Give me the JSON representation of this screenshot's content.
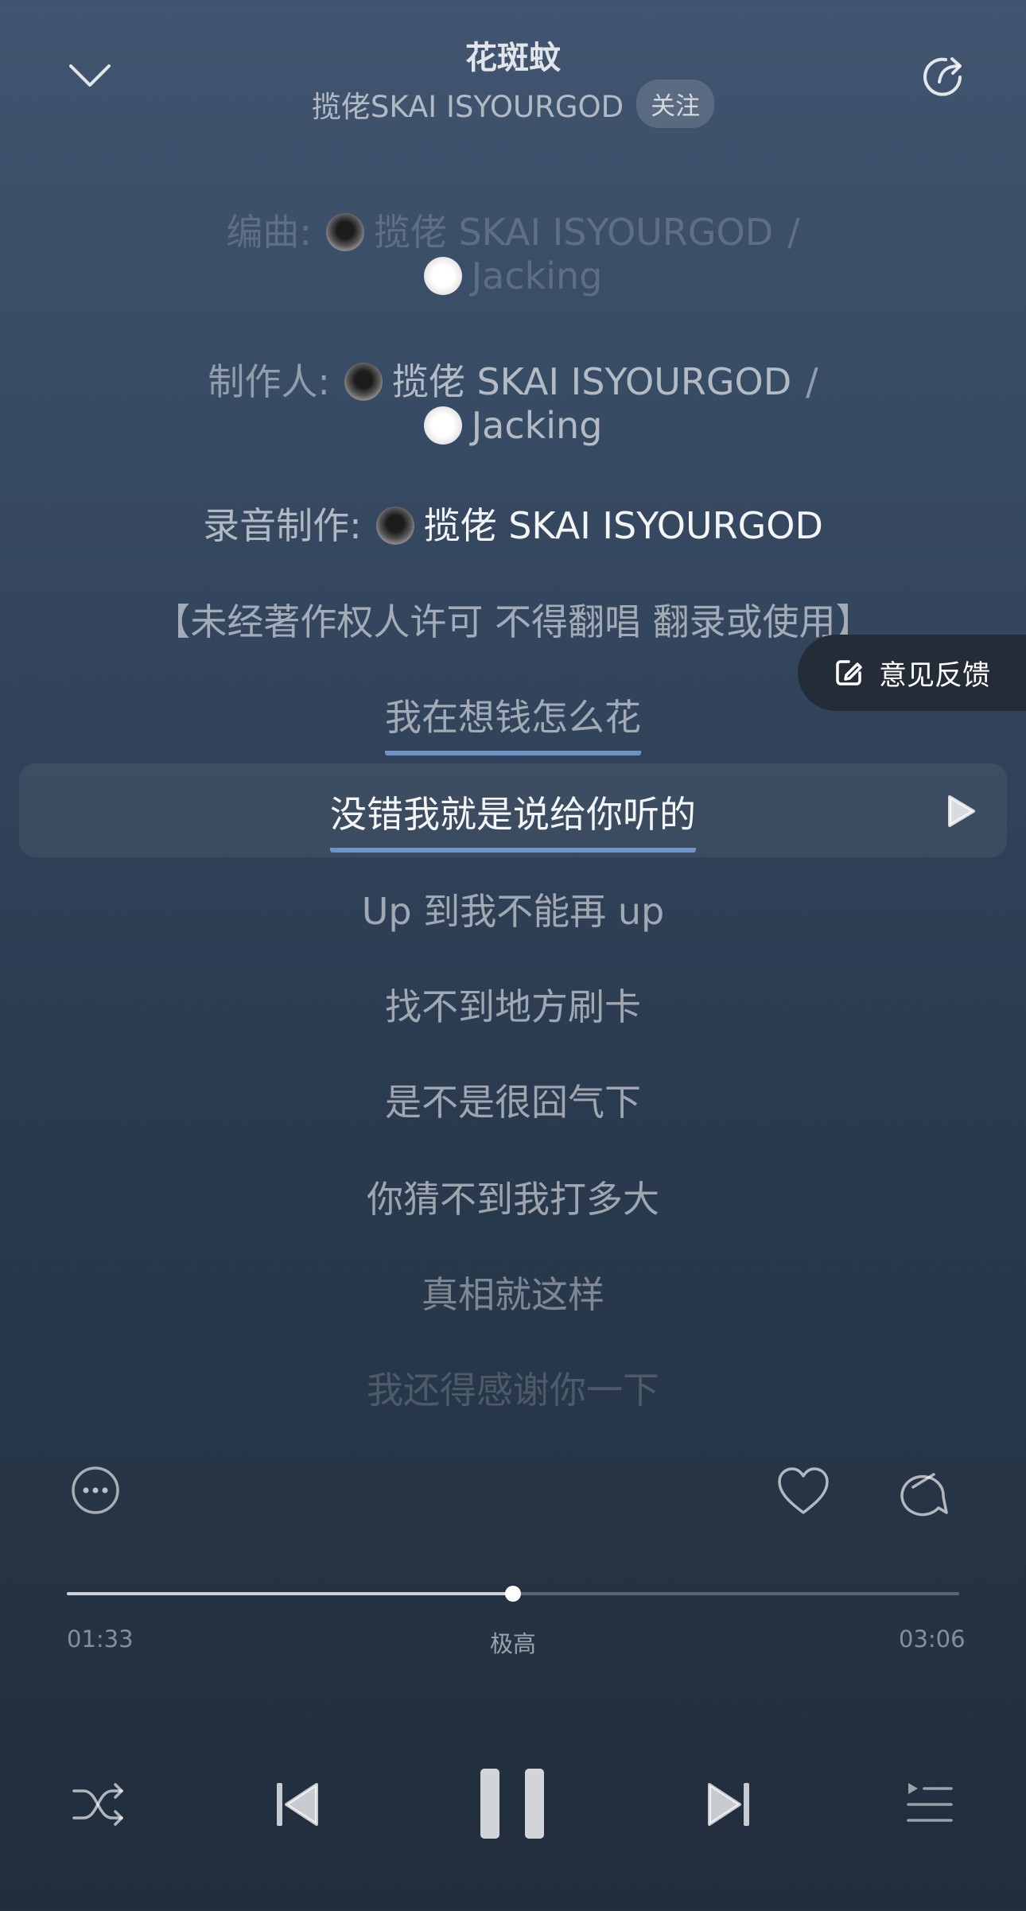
{
  "header": {
    "title": "花斑蚊",
    "artist": "揽佬SKAI ISYOURGOD",
    "follow_label": "关注"
  },
  "credits": [
    {
      "label": "编曲:",
      "names": [
        "揽佬 SKAI ISYOURGOD",
        "Jacking"
      ]
    },
    {
      "label": "制作人:",
      "names": [
        "揽佬 SKAI ISYOURGOD",
        "Jacking"
      ]
    },
    {
      "label": "录音制作:",
      "names": [
        "揽佬 SKAI ISYOURGOD"
      ]
    }
  ],
  "credit_separator": "/",
  "notice": "【未经著作权人许可 不得翻唱 翻录或使用】",
  "lyrics": {
    "prev": "我在想钱怎么花",
    "current": "没错我就是说给你听的",
    "upcoming": [
      "Up 到我不能再 up",
      "找不到地方刷卡",
      "是不是很囧气下",
      "你猜不到我打多大",
      "真相就这样",
      "我还得感谢你一下"
    ]
  },
  "feedback_label": "意见反馈",
  "player": {
    "elapsed": "01:33",
    "total": "03:06",
    "quality": "极高",
    "progress": 0.5
  },
  "icons": {
    "collapse": "chevron-down-icon",
    "share": "share-icon",
    "more": "more-icon",
    "like": "heart-icon",
    "comment": "comment-icon",
    "shuffle": "shuffle-icon",
    "previous": "previous-icon",
    "pause": "pause-icon",
    "next": "next-icon",
    "playlist": "playlist-icon"
  },
  "colors": {
    "accent_underline": "#6e93c4",
    "feedback_bg": "#232c37"
  }
}
